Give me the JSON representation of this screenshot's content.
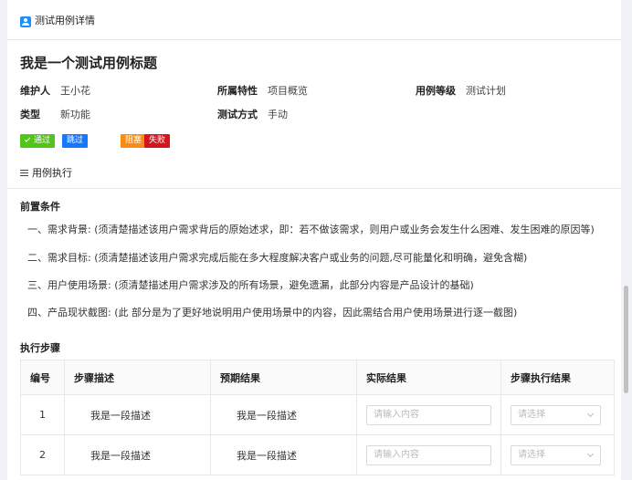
{
  "header": {
    "title": "测试用例详情",
    "icon": "user-case-icon"
  },
  "case": {
    "title": "我是一个测试用例标题"
  },
  "meta": {
    "owner_label": "维护人",
    "owner": "王小花",
    "attr_label": "所属特性",
    "attr": "项目概览",
    "level_label": "用例等级",
    "level": "测试计划",
    "type_label": "类型",
    "type": "新功能",
    "method_label": "测试方式",
    "method": "手动"
  },
  "status_tags": {
    "pass": "通过",
    "skip": "跳过",
    "block": "阻塞",
    "fail": "失败",
    "colors": {
      "pass": "#52c41a",
      "skip": "#1677ff",
      "block": "#fa8c16",
      "fail": "#d4141e"
    }
  },
  "exec_section": {
    "title": "用例执行",
    "icon": "list-icon"
  },
  "precondition": {
    "title": "前置条件",
    "items": [
      "一、需求背景: (须清楚描述该用户需求背后的原始述求，即：若不做该需求，则用户或业务会发生什么困难、发生困难的原因等)",
      "二、需求目标: (须清楚描述该用户需求完成后能在多大程度解决客户或业务的问题,尽可能量化和明确，避免含糊)",
      "三、用户使用场景: (须清楚描述用户需求涉及的所有场景，避免遗漏，此部分内容是产品设计的基础)",
      "四、产品现状截图: (此 部分是为了更好地说明用户使用场景中的内容，因此需结合用户使用场景进行逐一截图)"
    ]
  },
  "steps": {
    "title": "执行步骤",
    "columns": [
      "编号",
      "步骤描述",
      "预期结果",
      "实际结果",
      "步骤执行结果"
    ],
    "rows": [
      {
        "no": "1",
        "desc": "我是一段描述",
        "expected": "我是一段描述",
        "actual_placeholder": "请输入内容",
        "result_placeholder": "请选择"
      },
      {
        "no": "2",
        "desc": "我是一段描述",
        "expected": "我是一段描述",
        "actual_placeholder": "请输入内容",
        "result_placeholder": "请选择"
      }
    ]
  }
}
